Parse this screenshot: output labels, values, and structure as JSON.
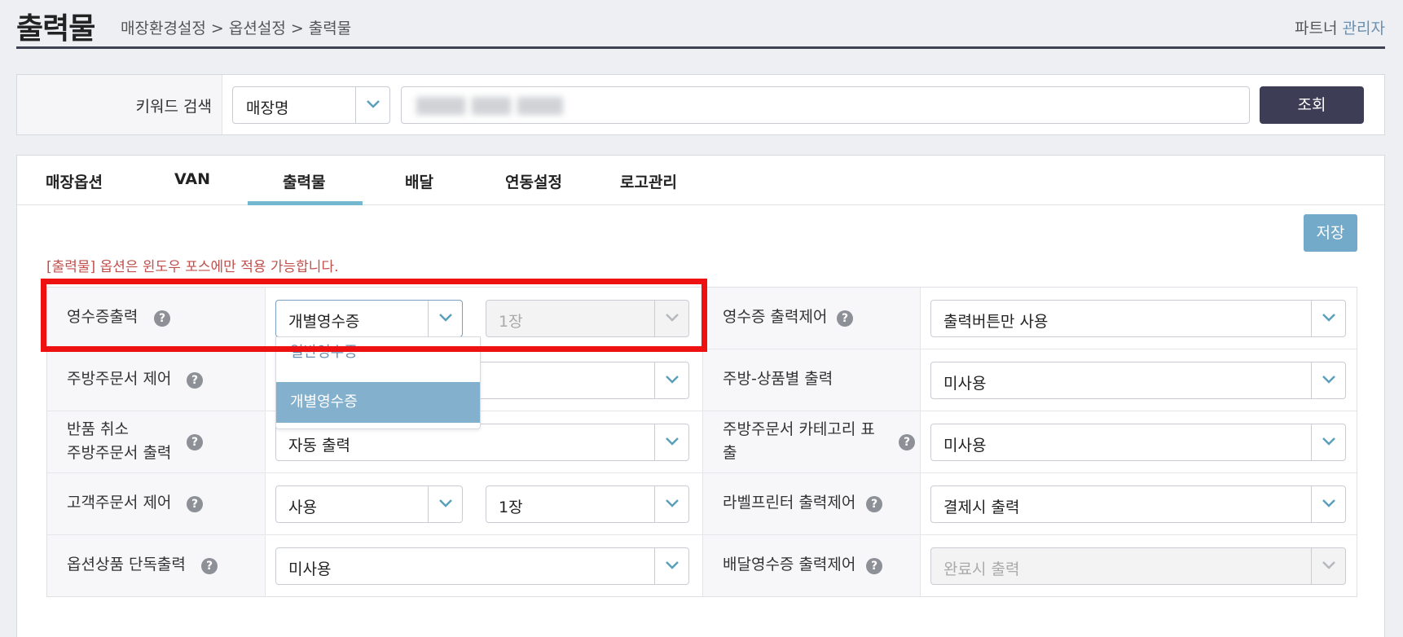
{
  "header": {
    "title": "출력물",
    "breadcrumb": "매장환경설정 > 옵션설정 > 출력물",
    "user_prefix": "파트너",
    "user_role": "관리자"
  },
  "search": {
    "label": "키워드 검색",
    "field_selected": "매장명",
    "button_label": "조회"
  },
  "tabs": [
    {
      "label": "매장옵션",
      "active": false
    },
    {
      "label": "VAN",
      "active": false
    },
    {
      "label": "출력물",
      "active": true
    },
    {
      "label": "배달",
      "active": false
    },
    {
      "label": "연동설정",
      "active": false
    },
    {
      "label": "로고관리",
      "active": false
    }
  ],
  "save_label": "저장",
  "notice": "[출력물] 옵션은 윈도우 포스에만 적용 가능합니다.",
  "help_glyph": "?",
  "rows": [
    {
      "left_label": "영수증출력",
      "left_value": "개별영수증",
      "left_value2": "1장",
      "right_label": "영수증 출력제어",
      "right_value": "출력버튼만 사용"
    },
    {
      "left_label": "주방주문서 제어",
      "left_value": "",
      "right_label": "주방-상품별 출력",
      "right_value": "미사용"
    },
    {
      "left_label_line1": "반품 취소",
      "left_label_line2": "주방주문서 출력",
      "left_value": "자동 출력",
      "right_label_line1": "주방주문서 카테고리 표",
      "right_label_line2": "출",
      "right_value": "미사용"
    },
    {
      "left_label": "고객주문서 제어",
      "left_value": "사용",
      "left_value2": "1장",
      "right_label": "라벨프린터 출력제어",
      "right_value": "결제시 출력"
    },
    {
      "left_label": "옵션상품 단독출력",
      "left_value": "미사용",
      "right_label": "배달영수증 출력제어",
      "right_value": "완료시 출력"
    }
  ],
  "dropdown_options": [
    "일반영수증",
    "개별영수증"
  ],
  "colors": {
    "accent": "#73b8cf",
    "search_button": "#3d3e55",
    "save_button": "#73a9c9",
    "notice": "#c0504d",
    "highlight": "#ee1111",
    "dropdown_selected": "#83b0cc"
  }
}
